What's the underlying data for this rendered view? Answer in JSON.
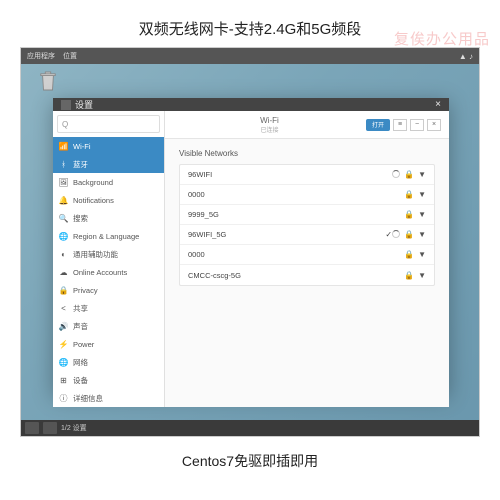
{
  "top_title": "双频无线网卡-支持2.4G和5G频段",
  "bottom_title": "Centos7免驱即插即用",
  "watermark": "复俟办公用品",
  "menubar": {
    "left1": "应用程序",
    "left2": "位置",
    "tray": "▲ ♪"
  },
  "window": {
    "title": "设置",
    "close": "×"
  },
  "search_placeholder": "Q",
  "sidebar": {
    "items": [
      {
        "icon": "📶",
        "label": "Wi-Fi",
        "active": true
      },
      {
        "icon": "ᚼ",
        "label": "蓝牙",
        "active": true
      },
      {
        "icon": "🖼",
        "label": "Background"
      },
      {
        "icon": "🔔",
        "label": "Notifications"
      },
      {
        "icon": "🔍",
        "label": "搜索"
      },
      {
        "icon": "🌐",
        "label": "Region & Language"
      },
      {
        "icon": "◐",
        "label": "通用辅助功能"
      },
      {
        "icon": "☁",
        "label": "Online Accounts"
      },
      {
        "icon": "🔒",
        "label": "Privacy"
      },
      {
        "icon": "<",
        "label": "共享"
      },
      {
        "icon": "🔊",
        "label": "声音"
      },
      {
        "icon": "⚡",
        "label": "Power"
      },
      {
        "icon": "🌐",
        "label": "网络"
      },
      {
        "icon": "⊞",
        "label": "设备"
      },
      {
        "icon": "ⓘ",
        "label": "详细信息"
      }
    ]
  },
  "header": {
    "title": "Wi-Fi",
    "subtitle": "已连接",
    "toggle": "打开",
    "btn1": "≡",
    "btn2": "−",
    "btn3": "×"
  },
  "section_label": "Visible Networks",
  "networks": [
    {
      "name": "96WIFI",
      "connected": false,
      "loading": true,
      "lock": true,
      "signal": "▼"
    },
    {
      "name": "0000",
      "connected": false,
      "loading": false,
      "lock": true,
      "signal": "▼"
    },
    {
      "name": "9999_5G",
      "connected": false,
      "loading": false,
      "lock": true,
      "signal": "▼"
    },
    {
      "name": "96WIFI_5G",
      "connected": true,
      "loading": true,
      "lock": true,
      "signal": "▼"
    },
    {
      "name": "0000",
      "connected": false,
      "loading": false,
      "lock": true,
      "signal": "▼"
    },
    {
      "name": "CMCC-cscg-5G",
      "connected": false,
      "loading": false,
      "lock": true,
      "signal": "▼"
    }
  ],
  "taskbar": {
    "label": "1/2 设置"
  }
}
